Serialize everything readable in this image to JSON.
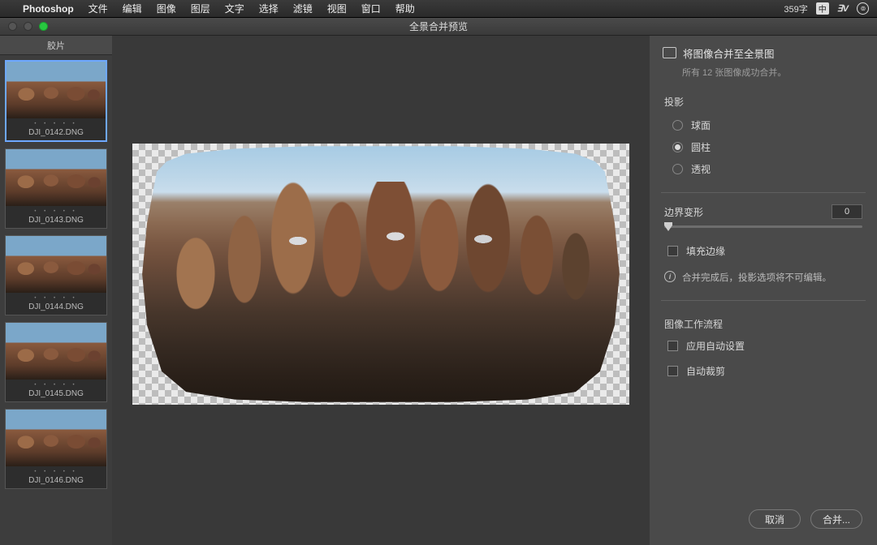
{
  "menubar": {
    "app": "Photoshop",
    "items": [
      "文件",
      "编辑",
      "图像",
      "图层",
      "文字",
      "选择",
      "滤镜",
      "视图",
      "窗口",
      "帮助"
    ],
    "right": {
      "wordcount": "359字",
      "ime": "中"
    }
  },
  "window": {
    "title": "全景合并预览"
  },
  "filmstrip": {
    "header": "胶片",
    "thumbs": [
      {
        "label": "DJI_0142.DNG",
        "selected": true
      },
      {
        "label": "DJI_0143.DNG",
        "selected": false
      },
      {
        "label": "DJI_0144.DNG",
        "selected": false
      },
      {
        "label": "DJI_0145.DNG",
        "selected": false
      },
      {
        "label": "DJI_0146.DNG",
        "selected": false
      }
    ]
  },
  "panel": {
    "heading": "将图像合并至全景图",
    "sub": "所有 12 张图像成功合并。",
    "projection": {
      "title": "投影",
      "options": {
        "spherical": "球面",
        "cylindrical": "圆柱",
        "perspective": "透视"
      },
      "selected": "cylindrical"
    },
    "boundary": {
      "label": "边界变形",
      "value": "0"
    },
    "fill_edges": {
      "label": "填充边缘",
      "checked": false
    },
    "info": "合并完成后，投影选项将不可编辑。",
    "workflow": {
      "title": "图像工作流程",
      "auto_settings": {
        "label": "应用自动设置",
        "checked": false
      },
      "auto_crop": {
        "label": "自动裁剪",
        "checked": false
      }
    },
    "buttons": {
      "cancel": "取消",
      "merge": "合并..."
    }
  }
}
